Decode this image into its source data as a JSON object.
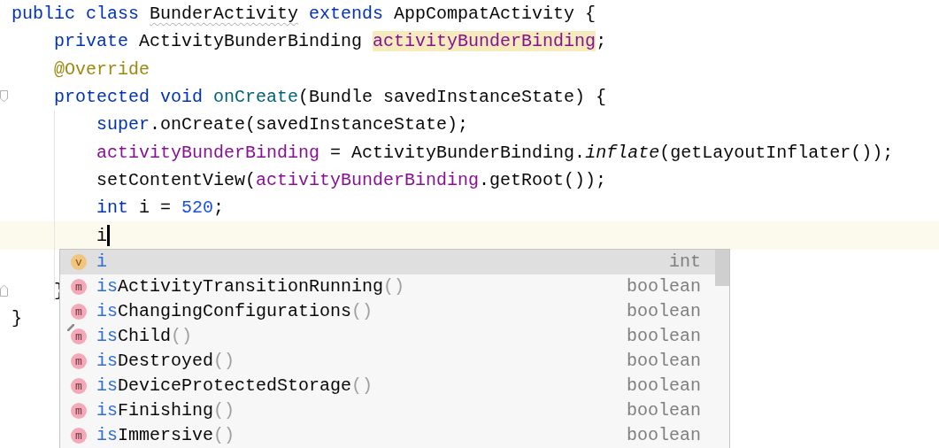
{
  "editor": {
    "lines": [
      {
        "current": false,
        "tokens": [
          {
            "text": "public class ",
            "kind": "keyword"
          },
          {
            "text": "BunderActivity",
            "kind": "typo"
          },
          {
            "text": " extends",
            "kind": "keyword"
          },
          {
            "text": " AppCompatActivity {",
            "kind": "plain"
          }
        ]
      },
      {
        "current": false,
        "tokens": [
          {
            "text": "    private ",
            "kind": "keyword"
          },
          {
            "text": "ActivityBunderBinding ",
            "kind": "plain"
          },
          {
            "text": "activityBunderBinding",
            "kind": "field-highlighted"
          },
          {
            "text": ";",
            "kind": "plain"
          }
        ]
      },
      {
        "current": false,
        "tokens": [
          {
            "text": "    @Override",
            "kind": "annotation"
          }
        ]
      },
      {
        "current": false,
        "fold_start": true,
        "tokens": [
          {
            "text": "    protected void ",
            "kind": "keyword"
          },
          {
            "text": "onCreate",
            "kind": "method-declaration"
          },
          {
            "text": "(Bundle savedInstanceState) {",
            "kind": "plain"
          }
        ]
      },
      {
        "current": false,
        "tokens": [
          {
            "text": "        super",
            "kind": "keyword"
          },
          {
            "text": ".onCreate(savedInstanceState);",
            "kind": "plain"
          }
        ]
      },
      {
        "current": false,
        "tokens": [
          {
            "text": "        activityBunderBinding",
            "kind": "field"
          },
          {
            "text": " = ActivityBunderBinding.",
            "kind": "plain"
          },
          {
            "text": "inflate",
            "kind": "static-call"
          },
          {
            "text": "(getLayoutInflater());",
            "kind": "plain"
          }
        ]
      },
      {
        "current": false,
        "tokens": [
          {
            "text": "        setContentView(",
            "kind": "plain"
          },
          {
            "text": "activityBunderBinding",
            "kind": "field"
          },
          {
            "text": ".getRoot());",
            "kind": "plain"
          }
        ]
      },
      {
        "current": false,
        "tokens": [
          {
            "text": "        int ",
            "kind": "keyword"
          },
          {
            "text": "i = ",
            "kind": "plain"
          },
          {
            "text": "520",
            "kind": "number"
          },
          {
            "text": ";",
            "kind": "plain"
          }
        ]
      },
      {
        "current": true,
        "caret": true,
        "tokens": [
          {
            "text": "        i",
            "kind": "plain"
          }
        ]
      },
      {
        "current": false
      },
      {
        "current": false,
        "fold_end": true,
        "tokens": [
          {
            "text": "    }",
            "kind": "plain"
          }
        ]
      },
      {
        "current": false,
        "tokens": [
          {
            "text": "}",
            "kind": "plain"
          }
        ]
      }
    ]
  },
  "completion": {
    "items": [
      {
        "kind": "variable",
        "badge": "v",
        "tagged": false,
        "match": "i",
        "type": "int",
        "selected": true
      },
      {
        "kind": "method",
        "badge": "m",
        "tagged": false,
        "match": "is",
        "rest": "ActivityTransitionRunning",
        "params": "()",
        "type": "boolean",
        "selected": false
      },
      {
        "kind": "method",
        "badge": "m",
        "tagged": false,
        "match": "is",
        "rest": "ChangingConfigurations",
        "params": "()",
        "type": "boolean",
        "selected": false
      },
      {
        "kind": "method",
        "badge": "m",
        "tagged": true,
        "match": "is",
        "rest": "Child",
        "params": "()",
        "type": "boolean",
        "selected": false
      },
      {
        "kind": "method",
        "badge": "m",
        "tagged": false,
        "match": "is",
        "rest": "Destroyed",
        "params": "()",
        "type": "boolean",
        "selected": false
      },
      {
        "kind": "method",
        "badge": "m",
        "tagged": false,
        "match": "is",
        "rest": "DeviceProtectedStorage",
        "params": "()",
        "type": "boolean",
        "selected": false
      },
      {
        "kind": "method",
        "badge": "m",
        "tagged": false,
        "match": "is",
        "rest": "Finishing",
        "params": "()",
        "type": "boolean",
        "selected": false
      },
      {
        "kind": "method",
        "badge": "m",
        "tagged": false,
        "match": "is",
        "rest": "Immersive",
        "params": "()",
        "type": "boolean",
        "selected": false
      }
    ]
  }
}
